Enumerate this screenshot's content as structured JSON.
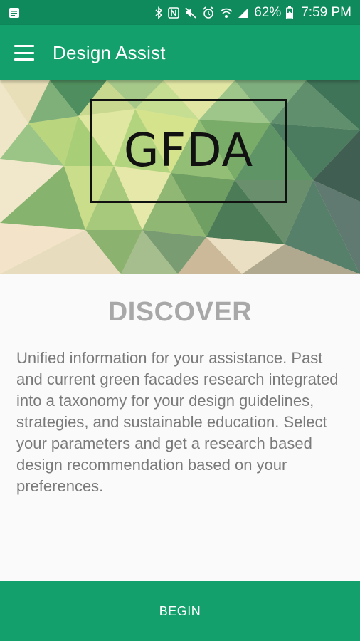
{
  "status_bar": {
    "battery_percent": "62%",
    "time": "7:59 PM",
    "icons": [
      "notification-icon",
      "bluetooth-icon",
      "nfc-icon",
      "mute-icon",
      "alarm-icon",
      "wifi-icon",
      "signal-icon",
      "battery-charging-icon"
    ]
  },
  "app_bar": {
    "title": "Design Assist",
    "menu_icon": "hamburger-menu-icon"
  },
  "hero": {
    "logo_text": "GFDA"
  },
  "main": {
    "heading": "DISCOVER",
    "description": "Unified information for your assistance. Past and current green facades research integrated into a taxonomy for your design guidelines, strategies, and sustainable education. Select your parameters and get a research based design recommendation based on your preferences."
  },
  "footer": {
    "begin_label": "BEGIN"
  },
  "colors": {
    "status_bar": "#0e8a5c",
    "primary": "#13a06c",
    "heading_text": "#a8a8a8",
    "body_text": "#7a7a7a",
    "background": "#fafafa"
  }
}
